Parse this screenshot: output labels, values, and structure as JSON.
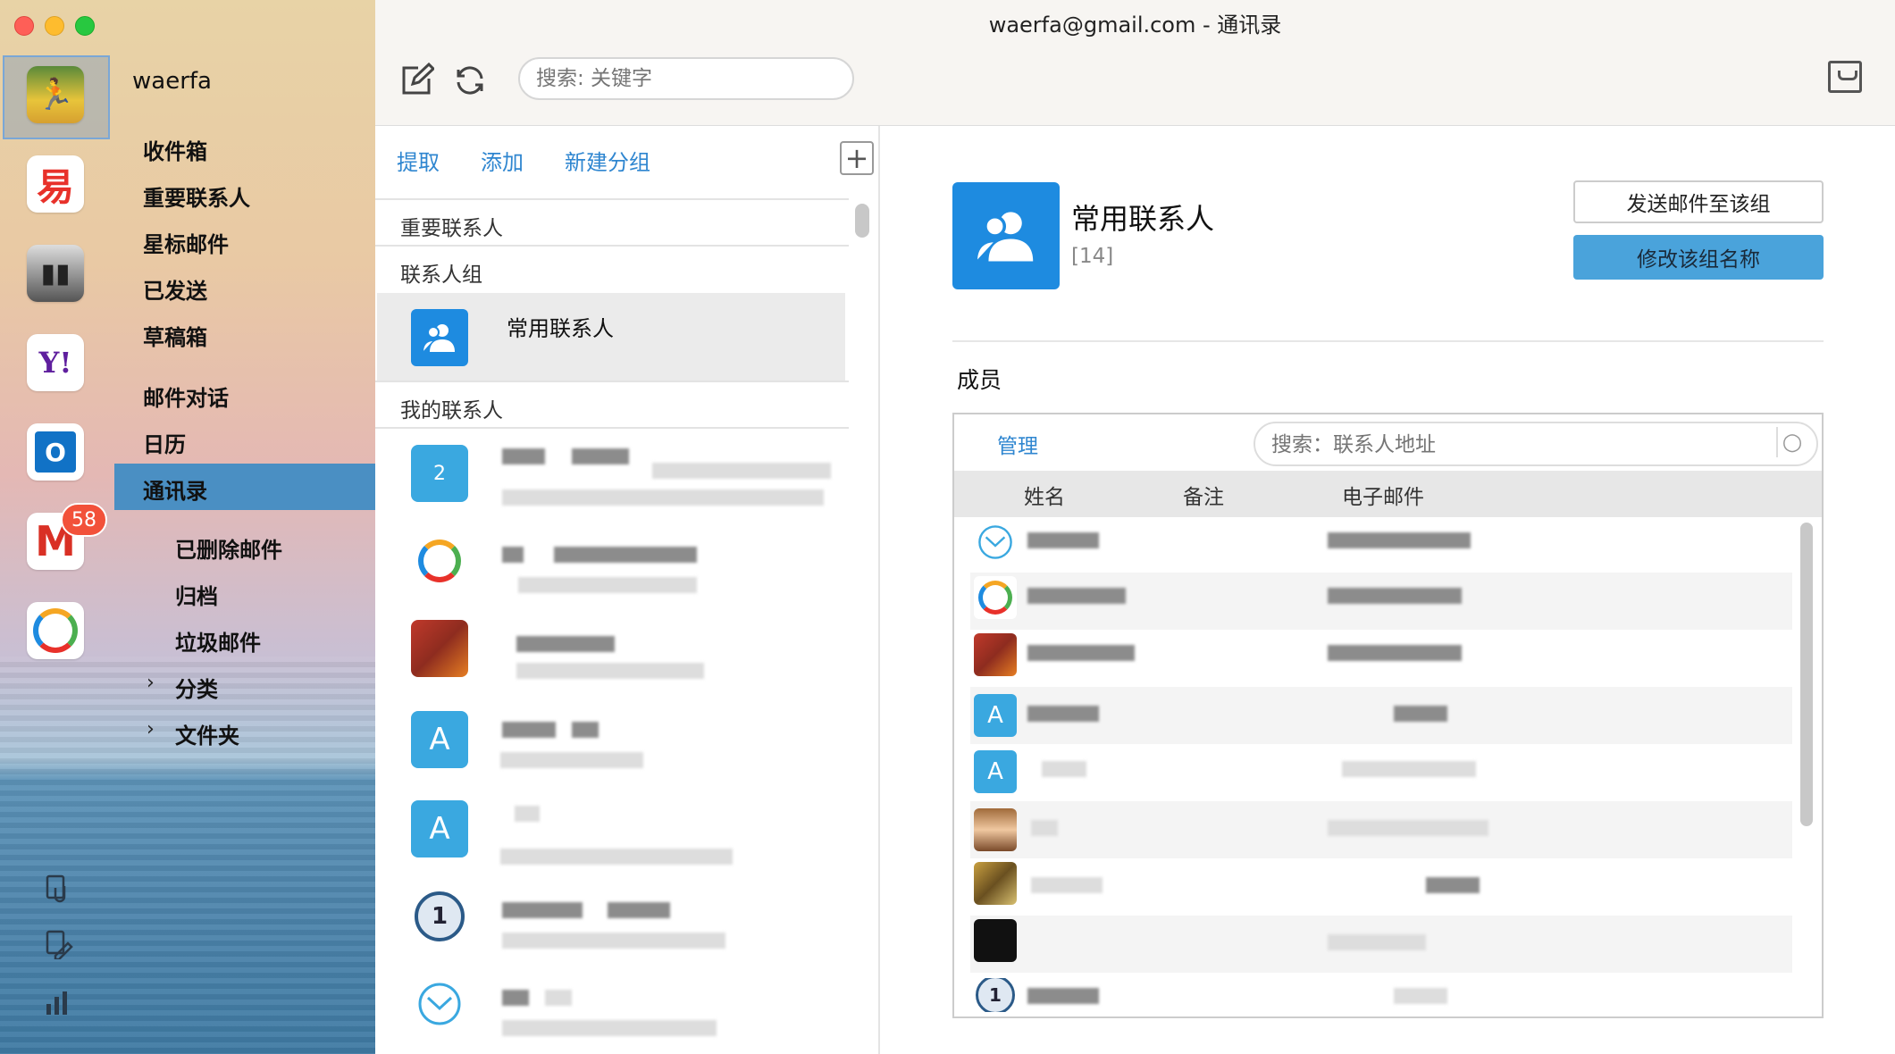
{
  "window": {
    "title": "waerfa@gmail.com  -  通讯录"
  },
  "sidebar": {
    "account_name": "waerfa",
    "folders": [
      {
        "label": "收件箱"
      },
      {
        "label": "重要联系人"
      },
      {
        "label": "星标邮件"
      },
      {
        "label": "已发送"
      },
      {
        "label": "草稿箱"
      },
      {
        "label": "邮件对话"
      },
      {
        "label": "日历"
      },
      {
        "label": "通讯录",
        "selected": true
      },
      {
        "label": "已删除邮件"
      },
      {
        "label": "归档"
      },
      {
        "label": "垃圾邮件"
      },
      {
        "label": "分类"
      },
      {
        "label": "文件夹"
      }
    ],
    "accounts": [
      {
        "icon": "photo-avatar-icon"
      },
      {
        "icon": "netease-163-icon"
      },
      {
        "icon": "photo-avatar-icon"
      },
      {
        "icon": "yahoo-icon",
        "text": "Y!"
      },
      {
        "icon": "outlook-icon"
      },
      {
        "icon": "gmail-icon",
        "text": "M",
        "badge": "58"
      },
      {
        "icon": "qq-mail-icon"
      }
    ],
    "unread_badge": "58"
  },
  "toolbar": {
    "search_placeholder": "搜索: 关键字"
  },
  "contacts_pane": {
    "actions": [
      "提取",
      "添加",
      "新建分组"
    ],
    "sections": {
      "important": "重要联系人",
      "groups": "联系人组",
      "mine": "我的联系人"
    },
    "group_selected": "常用联系人",
    "avatar_letters": {
      "count": "2",
      "a1": "A",
      "a2": "A"
    }
  },
  "detail": {
    "group_name": "常用联系人",
    "count": "[14]",
    "send_button": "发送邮件至该组",
    "rename_button": "修改该组名称",
    "members_label": "成员",
    "manage": "管理",
    "search_placeholder": "搜索：联系人地址",
    "columns": [
      "姓名",
      "备注",
      "电子邮件"
    ],
    "row_letters": {
      "a1": "A",
      "a2": "A"
    }
  },
  "colors": {
    "accent": "#2f86d0",
    "selected": "#4a8fc3",
    "group_icon": "#1e8be0",
    "badge": "#f2513a"
  }
}
